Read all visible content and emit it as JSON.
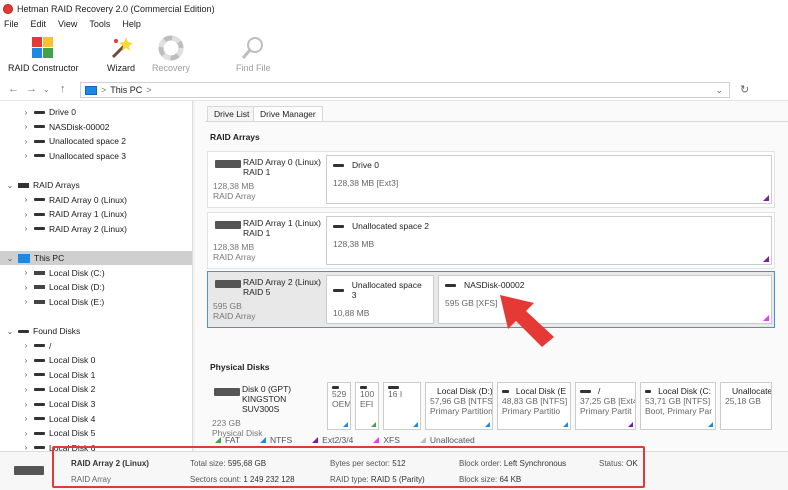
{
  "window": {
    "title": "Hetman RAID Recovery 2.0 (Commercial Edition)"
  },
  "menu": [
    "File",
    "Edit",
    "View",
    "Tools",
    "Help"
  ],
  "toolbar": {
    "raid_constructor": "RAID Constructor",
    "wizard": "Wizard",
    "recovery": "Recovery",
    "find_file": "Find File"
  },
  "address": {
    "path": "This PC",
    "separator": ">"
  },
  "sidebar": {
    "rows": [
      {
        "label": "Drive 0",
        "kind": "drive",
        "indent": 1,
        "chev": ">"
      },
      {
        "label": "NASDisk-00002",
        "kind": "drive",
        "indent": 1,
        "chev": ">"
      },
      {
        "label": "Unallocated space 2",
        "kind": "drive",
        "indent": 1,
        "chev": ">"
      },
      {
        "label": "Unallocated space 3",
        "kind": "drive",
        "indent": 1,
        "chev": ">"
      },
      {
        "label": "",
        "kind": "blank",
        "indent": 0,
        "chev": ""
      },
      {
        "label": "RAID Arrays",
        "kind": "raid",
        "indent": 0,
        "chev": "v"
      },
      {
        "label": "RAID Array 0 (Linux)",
        "kind": "drive",
        "indent": 1,
        "chev": ">"
      },
      {
        "label": "RAID Array 1 (Linux)",
        "kind": "drive",
        "indent": 1,
        "chev": ">"
      },
      {
        "label": "RAID Array 2 (Linux)",
        "kind": "drive",
        "indent": 1,
        "chev": ">"
      },
      {
        "label": "",
        "kind": "blank",
        "indent": 0,
        "chev": ""
      },
      {
        "label": "This PC",
        "kind": "pc",
        "indent": 0,
        "chev": "v",
        "selected": true
      },
      {
        "label": "Local Disk (C:)",
        "kind": "local",
        "indent": 1,
        "chev": ">"
      },
      {
        "label": "Local Disk (D:)",
        "kind": "local",
        "indent": 1,
        "chev": ">"
      },
      {
        "label": "Local Disk (E:)",
        "kind": "local",
        "indent": 1,
        "chev": ">"
      },
      {
        "label": "",
        "kind": "blank",
        "indent": 0,
        "chev": ""
      },
      {
        "label": "Found Disks",
        "kind": "drive",
        "indent": 0,
        "chev": "v"
      },
      {
        "label": "/",
        "kind": "drive",
        "indent": 1,
        "chev": ">"
      },
      {
        "label": "Local Disk 0",
        "kind": "drive",
        "indent": 1,
        "chev": ">"
      },
      {
        "label": "Local Disk 1",
        "kind": "drive",
        "indent": 1,
        "chev": ">"
      },
      {
        "label": "Local Disk 2",
        "kind": "drive",
        "indent": 1,
        "chev": ">"
      },
      {
        "label": "Local Disk 3",
        "kind": "drive",
        "indent": 1,
        "chev": ">"
      },
      {
        "label": "Local Disk 4",
        "kind": "drive",
        "indent": 1,
        "chev": ">"
      },
      {
        "label": "Local Disk 5",
        "kind": "drive",
        "indent": 1,
        "chev": ">"
      },
      {
        "label": "Local Disk 6",
        "kind": "drive",
        "indent": 1,
        "chev": ">"
      }
    ]
  },
  "tabs": {
    "drive_list": "Drive List",
    "drive_manager": "Drive Manager"
  },
  "sections": {
    "raid_arrays": "RAID Arrays",
    "physical_disks": "Physical Disks"
  },
  "raid_arrays": [
    {
      "name": "RAID Array 0 (Linux)",
      "level": "RAID 1",
      "size": "128,38 MB",
      "type": "RAID Array",
      "members": [
        {
          "name": "Drive 0",
          "detail": "128,38 MB [Ext3]"
        }
      ]
    },
    {
      "name": "RAID Array 1 (Linux)",
      "level": "RAID 1",
      "size": "128,38 MB",
      "type": "RAID Array",
      "members": [
        {
          "name": "Unallocated space 2",
          "detail": "128,38 MB"
        }
      ]
    },
    {
      "name": "RAID Array 2 (Linux)",
      "level": "RAID 5",
      "size": "595 GB",
      "type": "RAID Array",
      "members": [
        {
          "name": "Unallocated space 3",
          "detail": "10,88 MB"
        },
        {
          "name": "NASDisk-00002",
          "detail": "595 GB [XFS]"
        }
      ]
    }
  ],
  "physical_disk": {
    "name": "Disk 0 (GPT)",
    "model": "KINGSTON SUV300S",
    "size": "223 GB",
    "type": "Physical Disk"
  },
  "partitions": [
    {
      "l1": "",
      "l2": "529",
      "l3": "OEM"
    },
    {
      "l1": "",
      "l2": "100",
      "l3": "EFI"
    },
    {
      "l1": "",
      "l2": "16 I",
      "l3": ""
    },
    {
      "l1": "Local Disk (D:)",
      "l2": "57,96 GB [NTFS]",
      "l3": "Primary Partition"
    },
    {
      "l1": "Local Disk (E",
      "l2": "48,83 GB [NTFS]",
      "l3": "Primary Partitio"
    },
    {
      "l1": "/",
      "l2": "37,25 GB [Ext4]",
      "l3": "Primary Partit"
    },
    {
      "l1": "Local Disk (C:",
      "l2": "53,71 GB [NTFS]",
      "l3": "Boot, Primary Par"
    },
    {
      "l1": "Unallocated",
      "l2": "25,18 GB",
      "l3": ""
    }
  ],
  "legend": [
    {
      "label": "FAT",
      "color": "#43a047"
    },
    {
      "label": "NTFS",
      "color": "#1e88e5"
    },
    {
      "label": "Ext2/3/4",
      "color": "#7b1fa2"
    },
    {
      "label": "XFS",
      "color": "#e040fb"
    },
    {
      "label": "Unallocated",
      "color": "#bdbdbd"
    }
  ],
  "status": {
    "name": "RAID Array 2 (Linux)",
    "type": "RAID Array",
    "total_size_k": "Total size:",
    "total_size_v": "595,68 GB",
    "sectors_k": "Sectors count:",
    "sectors_v": "1 249 232 128",
    "bps_k": "Bytes per sector:",
    "bps_v": "512",
    "raid_type_k": "RAID type:",
    "raid_type_v": "RAID 5 (Parity)",
    "block_order_k": "Block order:",
    "block_order_v": "Left Synchronous",
    "block_size_k": "Block size:",
    "block_size_v": "64 KB",
    "status_k": "Status:",
    "status_v": "OK"
  },
  "colors": {
    "highlight": "#e53935",
    "selection_border": "#4a90d9"
  }
}
